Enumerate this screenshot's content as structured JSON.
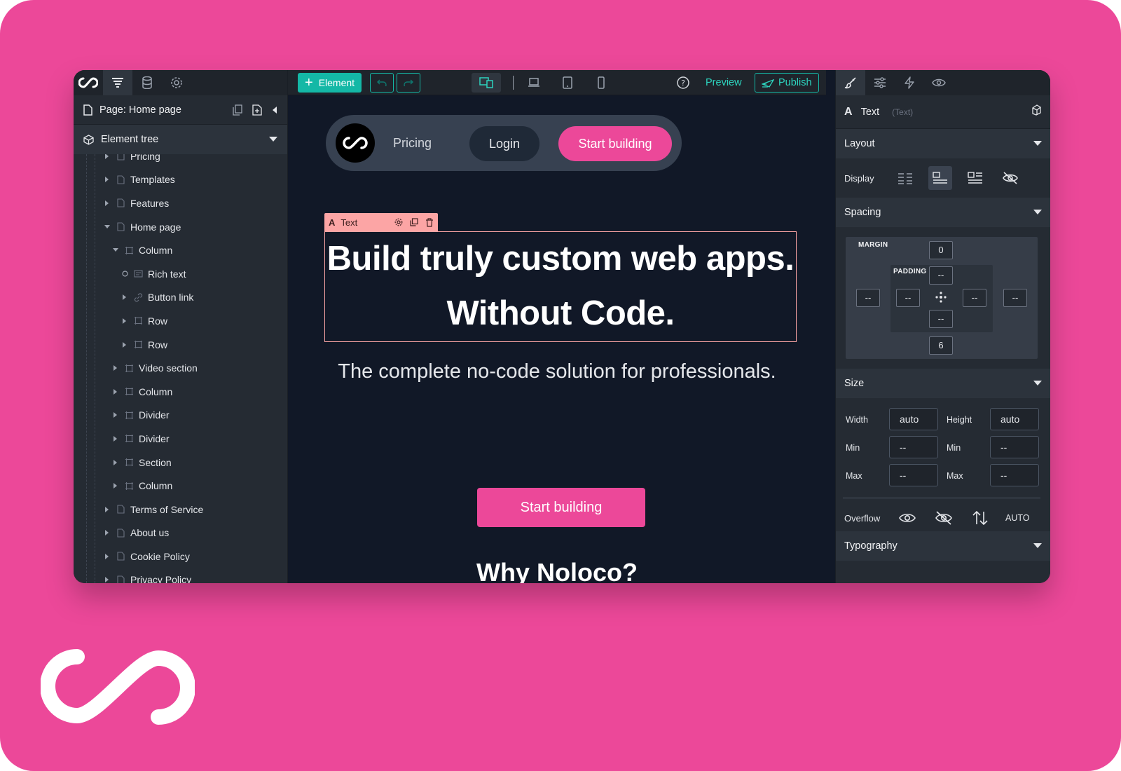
{
  "left_panel": {
    "page_title": "Page: Home page",
    "tree_header": "Element tree",
    "tree": [
      {
        "label": "Pricing",
        "depth": 1,
        "type": "page",
        "caret": "right"
      },
      {
        "label": "Templates",
        "depth": 1,
        "type": "page",
        "caret": "right"
      },
      {
        "label": "Features",
        "depth": 1,
        "type": "page",
        "caret": "right"
      },
      {
        "label": "Home page",
        "depth": 1,
        "type": "page",
        "caret": "down"
      },
      {
        "label": "Column",
        "depth": 2,
        "type": "block",
        "caret": "down"
      },
      {
        "label": "Rich text",
        "depth": 3,
        "type": "text",
        "caret": "circle"
      },
      {
        "label": "Button link",
        "depth": 3,
        "type": "link",
        "caret": "right"
      },
      {
        "label": "Row",
        "depth": 3,
        "type": "block",
        "caret": "right"
      },
      {
        "label": "Row",
        "depth": 3,
        "type": "block",
        "caret": "right"
      },
      {
        "label": "Video section",
        "depth": 2,
        "type": "block",
        "caret": "right"
      },
      {
        "label": "Column",
        "depth": 2,
        "type": "block",
        "caret": "right"
      },
      {
        "label": "Divider",
        "depth": 2,
        "type": "block",
        "caret": "right"
      },
      {
        "label": "Divider",
        "depth": 2,
        "type": "block",
        "caret": "right"
      },
      {
        "label": "Section",
        "depth": 2,
        "type": "block",
        "caret": "right"
      },
      {
        "label": "Column",
        "depth": 2,
        "type": "block",
        "caret": "right"
      },
      {
        "label": "Terms of Service",
        "depth": 1,
        "type": "page",
        "caret": "right"
      },
      {
        "label": "About us",
        "depth": 1,
        "type": "page",
        "caret": "right"
      },
      {
        "label": "Cookie Policy",
        "depth": 1,
        "type": "page",
        "caret": "right"
      },
      {
        "label": "Privacy Policy",
        "depth": 1,
        "type": "page",
        "caret": "right"
      }
    ]
  },
  "topbar": {
    "element_label": "Element",
    "preview_label": "Preview",
    "publish_label": "Publish"
  },
  "canvas": {
    "nav": {
      "pricing": "Pricing",
      "login": "Login",
      "start": "Start building"
    },
    "selection_label": "Text",
    "headline_line1": "Build truly custom web apps.",
    "headline_line2": "Without Code.",
    "subline": "The complete no-code solution for professionals.",
    "cta": "Start building",
    "section_heading": "Why Noloco?"
  },
  "right_panel": {
    "element_name": "Text",
    "element_type": "(Text)",
    "layout": {
      "title": "Layout",
      "display_label": "Display"
    },
    "spacing": {
      "title": "Spacing",
      "margin_label": "MARGIN",
      "padding_label": "PADDING",
      "margin_top": "0",
      "margin_right": "--",
      "margin_bottom": "6",
      "margin_left": "--",
      "padding_top": "--",
      "padding_right": "--",
      "padding_bottom": "--",
      "padding_left": "--"
    },
    "size": {
      "title": "Size",
      "width_label": "Width",
      "height_label": "Height",
      "width_value": "auto",
      "height_value": "auto",
      "min_label": "Min",
      "max_label": "Max",
      "min_width": "--",
      "min_height": "--",
      "max_width": "--",
      "max_height": "--",
      "overflow_label": "Overflow",
      "overflow_auto": "AUTO"
    },
    "typography": {
      "title": "Typography"
    }
  },
  "colors": {
    "brand_pink": "#ec4899",
    "teal": "#14b8a6",
    "canvas_bg": "#111827",
    "panel_bg": "#252b33",
    "selection": "#fca5a5"
  }
}
